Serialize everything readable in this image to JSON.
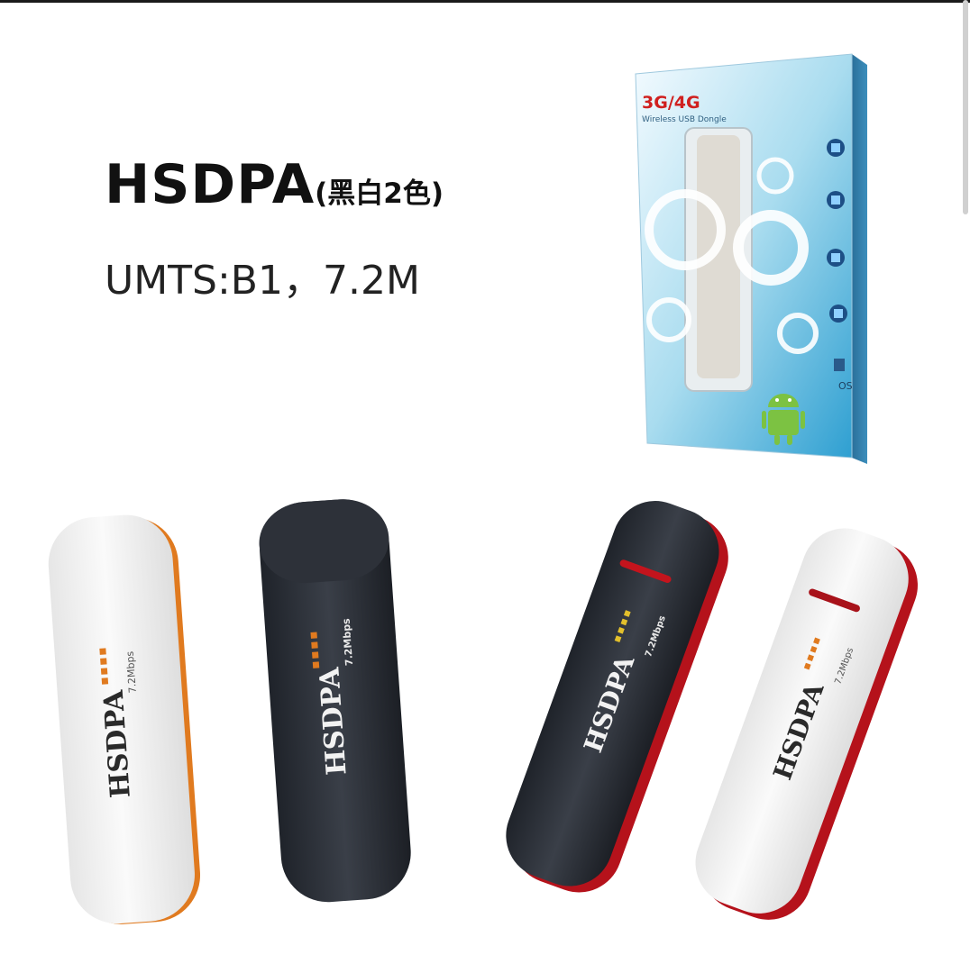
{
  "headline": {
    "title": "HSDPA",
    "variant": "(黑白2色)"
  },
  "spec": "UMTS:B1，7.2M",
  "package": {
    "badge": "3G/4G",
    "subtitle": "Wireless USB Dongle",
    "os_label": "OS"
  },
  "dongle_text": {
    "brand": "HSDPA",
    "speed": "7.2Mbps"
  },
  "colors": {
    "black_body": "#2b2f37",
    "white_body": "#f2f2f2",
    "orange_trim": "#e07a1f",
    "red_trim": "#b5121b",
    "box_blue": "#4fb6dd"
  }
}
